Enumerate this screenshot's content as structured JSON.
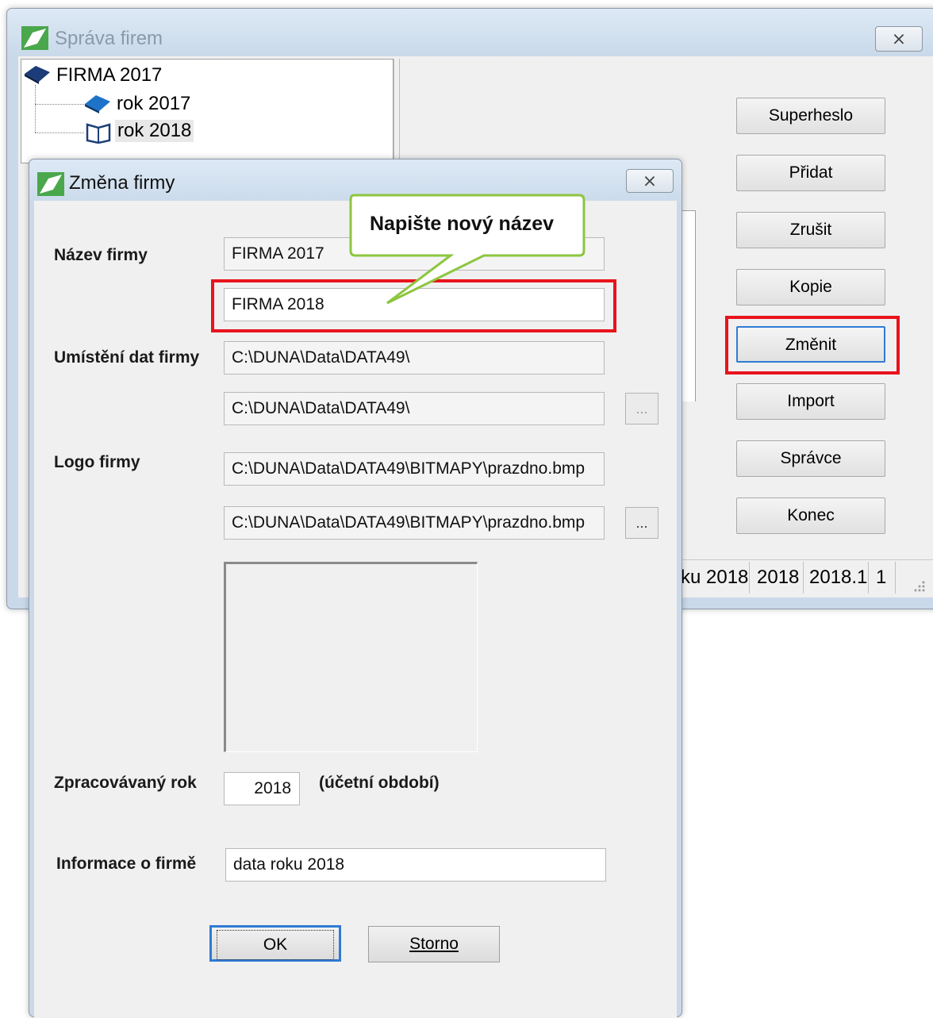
{
  "main_window": {
    "title": "Správa firem",
    "close_glyph": "⨯",
    "tree": {
      "root": "FIRMA 2017",
      "children": [
        "rok 2017",
        "rok 2018"
      ]
    },
    "buttons": [
      "Superheslo",
      "Přidat",
      "Zrušit",
      "Kopie",
      "Změnit",
      "Import",
      "Správce",
      "Konec"
    ],
    "status": [
      "ku 2018",
      "2018",
      "2018.1",
      "1"
    ]
  },
  "dialog": {
    "title": "Změna firmy",
    "close_glyph": "⨯",
    "callout": "Napište nový název",
    "labels": {
      "name": "Název firmy",
      "location": "Umístění dat firmy",
      "logo": "Logo firmy",
      "year": "Zpracovávaný rok",
      "year_note": "(účetní období)",
      "info": "Informace o firmě"
    },
    "fields": {
      "name_old": "FIRMA 2017",
      "name_new": "FIRMA 2018",
      "location_1": "C:\\DUNA\\Data\\DATA49\\",
      "location_2": "C:\\DUNA\\Data\\DATA49\\",
      "logo_1": "C:\\DUNA\\Data\\DATA49\\BITMAPY\\prazdno.bmp",
      "logo_2": "C:\\DUNA\\Data\\DATA49\\BITMAPY\\prazdno.bmp",
      "year": "2018",
      "info": "data roku 2018"
    },
    "browse_glyph": "...",
    "ok_label": "OK",
    "cancel_label": "Storno"
  },
  "colors": {
    "highlight": "#e8141c",
    "callout": "#8dc63f",
    "focus": "#2f7bd4"
  }
}
